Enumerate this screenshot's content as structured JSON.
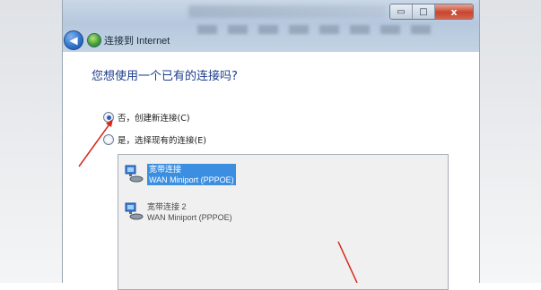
{
  "window": {
    "title": "连接到 Internet",
    "caption_buttons": {
      "minimize": "▭",
      "maximize": "□",
      "close": "x"
    },
    "back_symbol": "◀"
  },
  "main": {
    "question": "您想使用一个已有的连接吗?",
    "options": [
      {
        "label": "否，创建新连接(C)",
        "selected": true
      },
      {
        "label": "是，选择现有的连接(E)",
        "selected": false
      }
    ],
    "connections": [
      {
        "name": "宽带连接",
        "device": "WAN Miniport (PPPOE)",
        "selected": true,
        "icon": "network-adapter-icon"
      },
      {
        "name": "宽带连接 2",
        "device": "WAN Miniport (PPPOE)",
        "selected": false,
        "icon": "network-adapter-icon"
      }
    ]
  },
  "annotation_color": "#d42a1e"
}
